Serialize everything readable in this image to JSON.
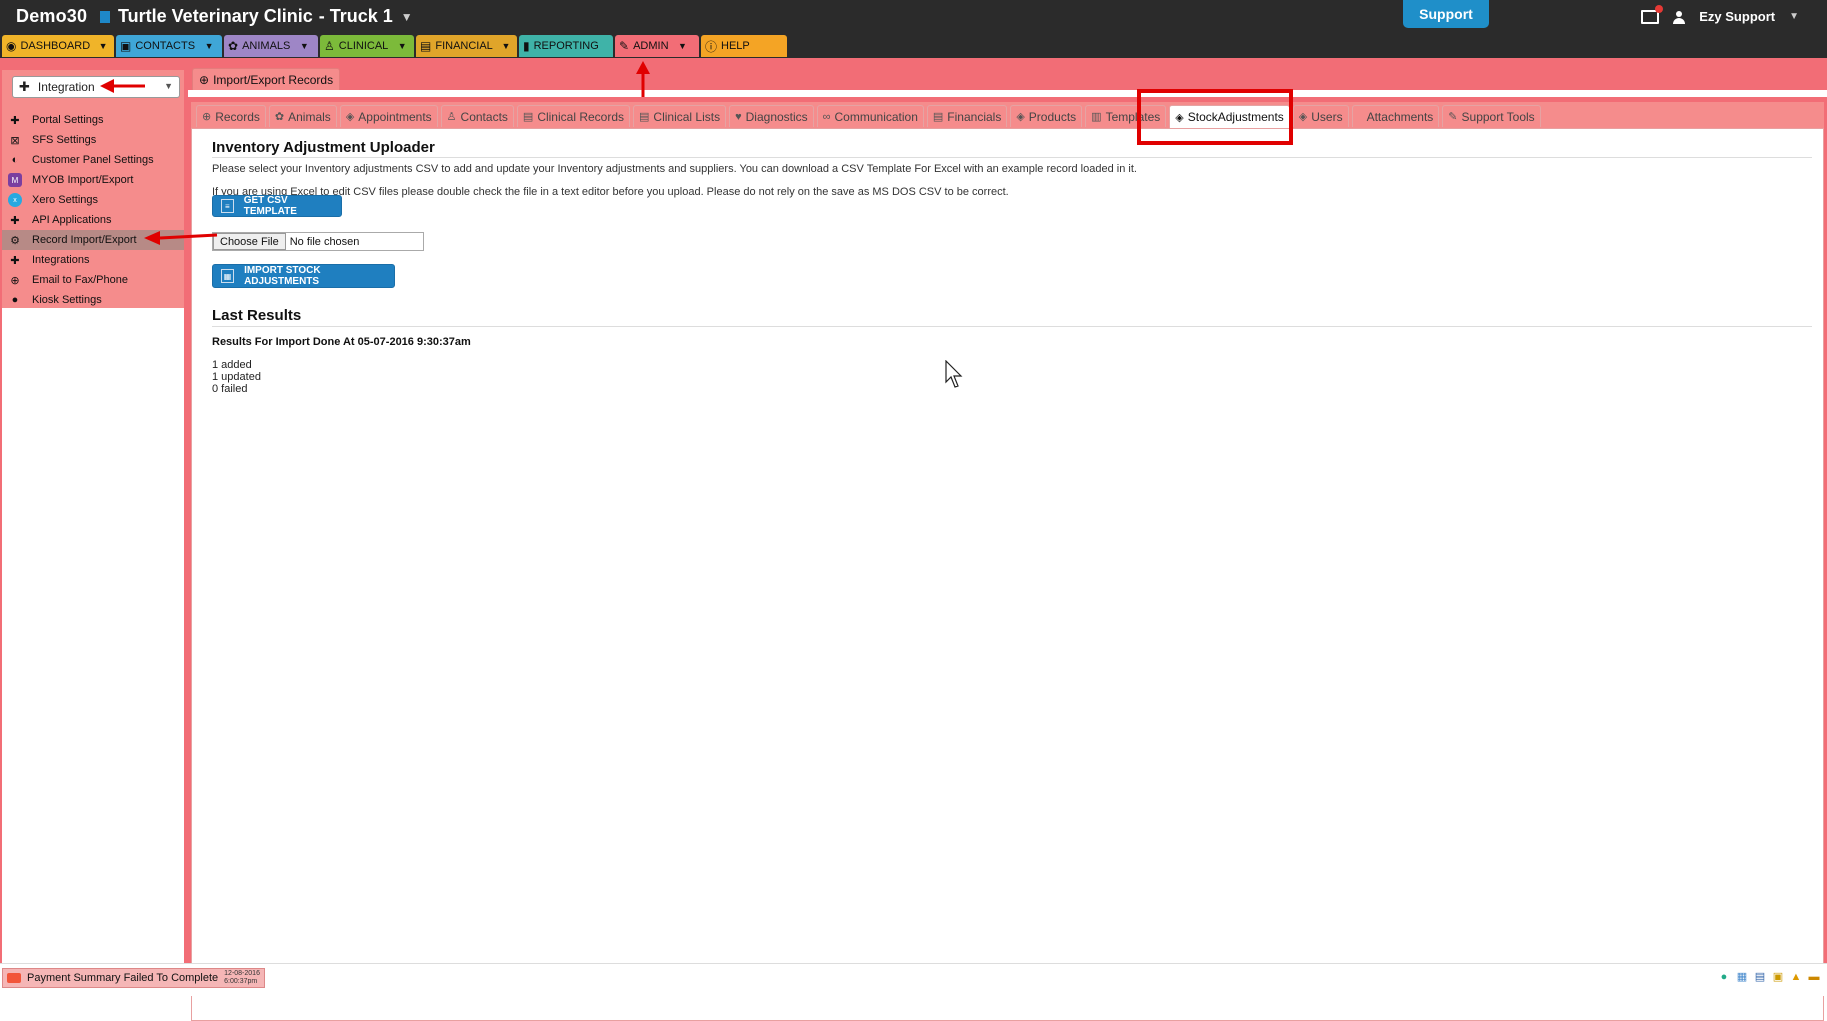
{
  "header": {
    "account": "Demo30",
    "clinic": "Turtle Veterinary Clinic",
    "location": "- Truck 1",
    "support_label": "Support",
    "user_name": "Ezy Support"
  },
  "main_nav": [
    {
      "label": "DASHBOARD",
      "icon": "dashboard-icon",
      "color": "#f0b429"
    },
    {
      "label": "CONTACTS",
      "icon": "contact-card-icon",
      "color": "#3fa6d7"
    },
    {
      "label": "ANIMALS",
      "icon": "paw-icon",
      "color": "#9e86c6"
    },
    {
      "label": "CLINICAL",
      "icon": "stethoscope-icon",
      "color": "#7cba3a"
    },
    {
      "label": "FINANCIAL",
      "icon": "ledger-icon",
      "color": "#e0a52a"
    },
    {
      "label": "REPORTING",
      "icon": "bar-chart-icon",
      "color": "#3fb3a8"
    },
    {
      "label": "ADMIN",
      "icon": "wrench-icon",
      "color": "#f26d76"
    },
    {
      "label": "HELP",
      "icon": "question-icon",
      "color": "#f4a425"
    }
  ],
  "sidebar": {
    "select_value": "Integration",
    "items": [
      {
        "label": "Portal Settings",
        "icon": "puzzle-icon"
      },
      {
        "label": "SFS Settings",
        "icon": "sfs-icon"
      },
      {
        "label": "Customer Panel Settings",
        "icon": "panel-icon"
      },
      {
        "label": "MYOB Import/Export",
        "icon": "myob-icon"
      },
      {
        "label": "Xero Settings",
        "icon": "xero-icon"
      },
      {
        "label": "API Applications",
        "icon": "puzzle-icon"
      },
      {
        "label": "Record Import/Export",
        "icon": "gears-icon"
      },
      {
        "label": "Integrations",
        "icon": "puzzle-icon"
      },
      {
        "label": "Email to Fax/Phone",
        "icon": "fax-icon"
      },
      {
        "label": "Kiosk Settings",
        "icon": "person-icon"
      }
    ]
  },
  "page_tab": "Import/Export Records",
  "subtabs": [
    {
      "label": "Records",
      "icon": "globe-icon"
    },
    {
      "label": "Animals",
      "icon": "paw-icon"
    },
    {
      "label": "Appointments",
      "icon": "cube-icon"
    },
    {
      "label": "Contacts",
      "icon": "person-icon"
    },
    {
      "label": "Clinical Records",
      "icon": "ledger-icon"
    },
    {
      "label": "Clinical Lists",
      "icon": "ledger-icon"
    },
    {
      "label": "Diagnostics",
      "icon": "heart-icon"
    },
    {
      "label": "Communication",
      "icon": "link-icon"
    },
    {
      "label": "Financials",
      "icon": "ledger-icon"
    },
    {
      "label": "Products",
      "icon": "cube-icon"
    },
    {
      "label": "Templates",
      "icon": "template-icon"
    },
    {
      "label": "StockAdjustments",
      "icon": "cube-icon"
    },
    {
      "label": "Users",
      "icon": "cube-icon"
    },
    {
      "label": "Attachments",
      "icon": ""
    },
    {
      "label": "Support Tools",
      "icon": "wrench-icon"
    }
  ],
  "uploader": {
    "title": "Inventory Adjustment Uploader",
    "intro": "Please select your Inventory adjustments CSV to add and update your Inventory adjustments and suppliers. You can download a CSV Template For Excel with an example record loaded in it.",
    "excel_note": "If you are using Excel to edit CSV files please double check the file in a text editor before you upload. Please do not rely on the save as MS DOS CSV to be correct.",
    "template_button": "GET CSV TEMPLATE",
    "choose_file": "Choose File",
    "no_file": "No file chosen",
    "import_button": "IMPORT STOCK ADJUSTMENTS"
  },
  "last_results": {
    "title": "Last Results",
    "summary": "Results For Import Done At 05-07-2016 9:30:37am",
    "lines": [
      "1 added",
      "1 updated",
      "0 failed"
    ]
  },
  "status_bar": {
    "notice": "Payment Summary Failed To Complete",
    "date": "12-08-2016",
    "time": "6:00:37pm"
  },
  "colors": {
    "admin_pink": "#f26d76",
    "primary_blue": "#1f7fc0",
    "annotation_red": "#e00000"
  }
}
